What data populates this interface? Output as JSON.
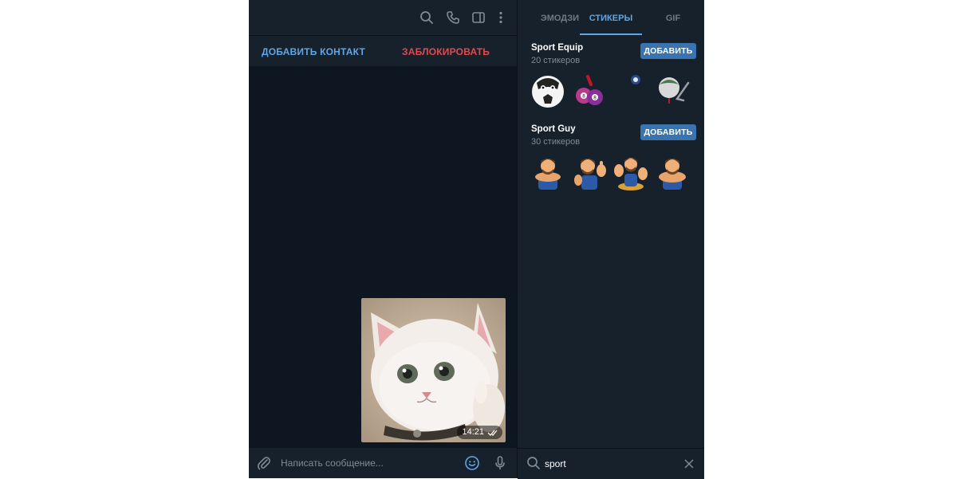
{
  "chat": {
    "header_icons": [
      "search-icon",
      "phone-icon",
      "sidebar-toggle-icon",
      "more-vertical-icon"
    ],
    "actions": {
      "add_contact": "ДОБАВИТЬ КОНТАКТ",
      "block": "ЗАБЛОКИРОВАТЬ"
    },
    "message": {
      "type": "sticker-image",
      "time": "14:21",
      "status_icon": "double-check-icon"
    },
    "composer": {
      "placeholder": "Написать сообщение...",
      "value": "",
      "icons": [
        "paperclip-icon",
        "smile-icon",
        "microphone-icon"
      ]
    }
  },
  "sticker_panel": {
    "tabs": [
      "ЭМОДЗИ",
      "СТИКЕРЫ",
      "GIF"
    ],
    "active_tab": "СТИКЕРЫ",
    "packs": [
      {
        "title": "Sport Equip",
        "count": "20 стикеров",
        "add_label": "ДОБАВИТЬ"
      },
      {
        "title": "Sport Guy",
        "count": "30 стикеров",
        "add_label": "ДОБАВИТЬ"
      }
    ],
    "search": {
      "value": "sport",
      "icon": "search-icon",
      "clear_icon": "close-icon"
    }
  },
  "colors": {
    "background": "#0e1621",
    "panel": "#17212b",
    "accent": "#5fa6e6",
    "danger": "#e5484d",
    "button": "#3a74b0",
    "muted_text": "#7f8b96"
  }
}
